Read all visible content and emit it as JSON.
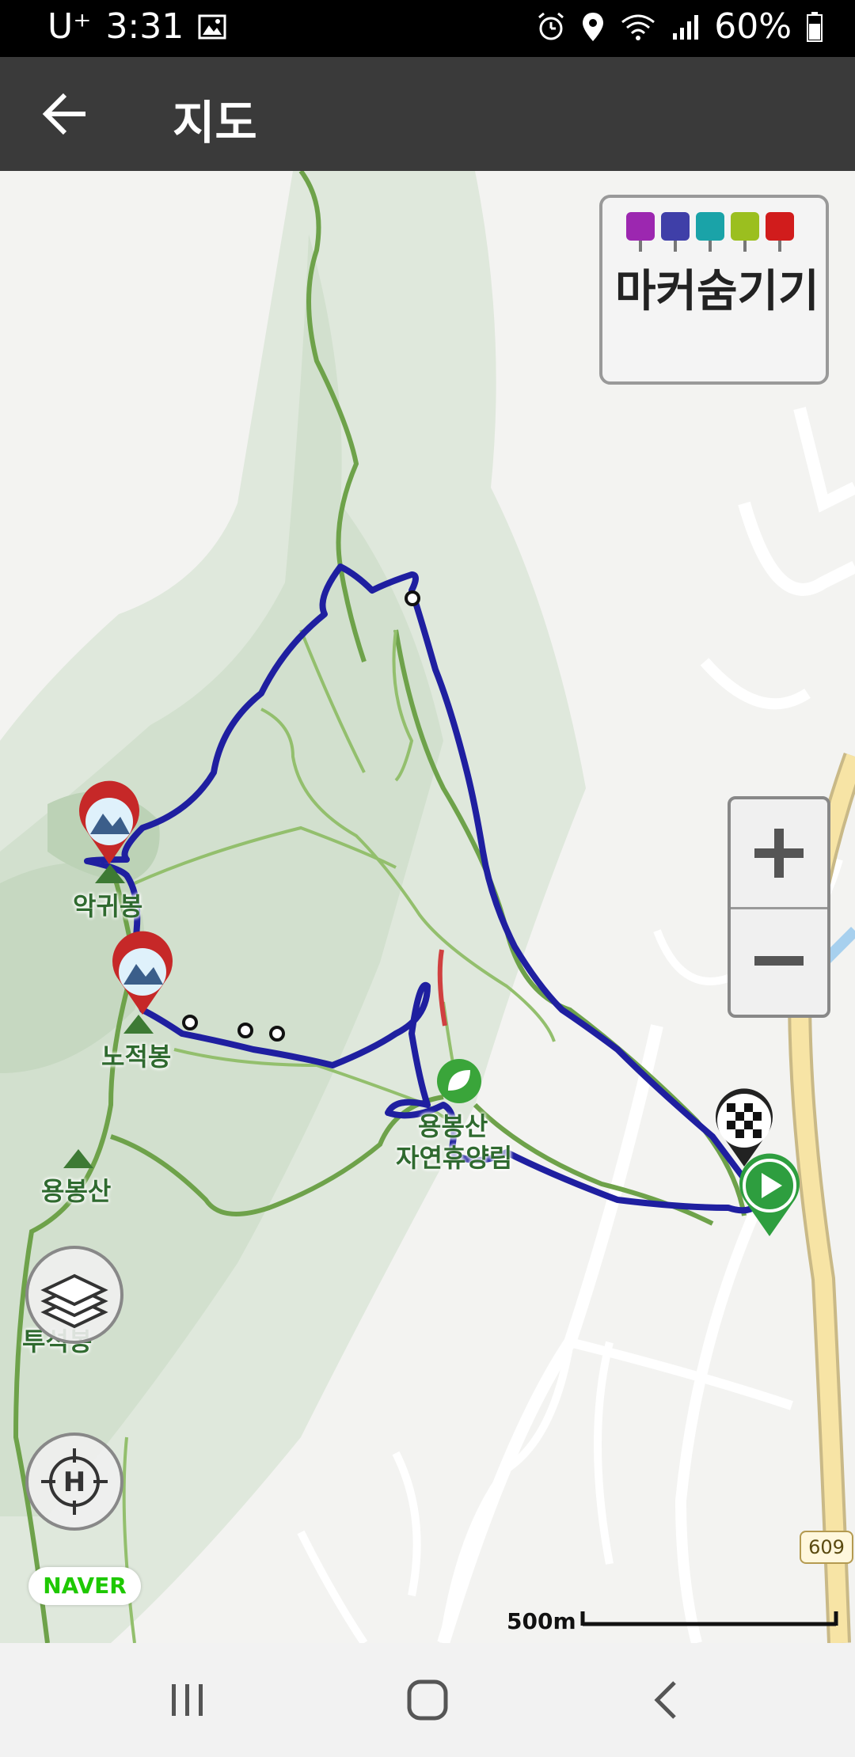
{
  "status_bar": {
    "carrier": "U⁺",
    "time": "3:31",
    "battery": "60%",
    "icons": [
      "image-icon",
      "alarm-icon",
      "location-icon",
      "wifi-icon",
      "signal-icon",
      "battery-icon"
    ]
  },
  "app_bar": {
    "title": "지도",
    "back_icon": "arrow-left-icon"
  },
  "map": {
    "marker_toggle": {
      "label": "마커숨기기",
      "icon_colors": [
        "#9c27b0",
        "#3f3fa8",
        "#1aa3a8",
        "#9bbf1f",
        "#d11c1c"
      ]
    },
    "places": {
      "peak1": "악귀봉",
      "peak2": "노적봉",
      "peak3": "용봉산",
      "peak4": "투석봉",
      "forest_line1": "용봉산",
      "forest_line2": "자연휴양림"
    },
    "route_color": "#1f1fa0",
    "zoom_in_label": "+",
    "zoom_out_label": "−",
    "provider": "NAVER",
    "scale_label": "500m",
    "road_number": "609"
  }
}
